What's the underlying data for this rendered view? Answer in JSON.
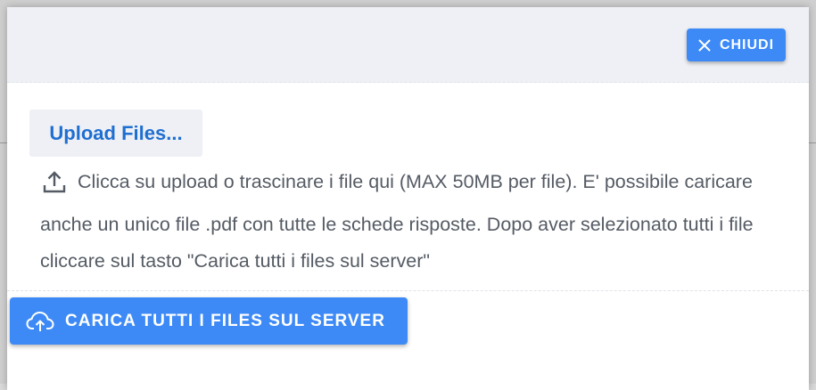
{
  "backdrop": {
    "text_lines": [
      "",
      ""
    ]
  },
  "header": {
    "close_label": "CHIUDI",
    "close_icon": "close-icon"
  },
  "body": {
    "upload_files_label": "Upload Files...",
    "upload_icon": "upload-icon",
    "instructions": "Clicca su upload o trascinare i file qui (MAX 50MB per file). E' possibile caricare anche un unico file .pdf con tutte le schede risposte. Dopo aver selezionato tutti i file cliccare sul tasto \"Carica tutti i files sul server\""
  },
  "footer": {
    "upload_all_label": "CARICA TUTTI I FILES SUL SERVER",
    "upload_all_icon": "cloud-upload-icon"
  },
  "colors": {
    "accent": "#3d8af7",
    "link": "#1f6fd1",
    "header_bg": "#eef0f5",
    "text": "#555b64"
  }
}
